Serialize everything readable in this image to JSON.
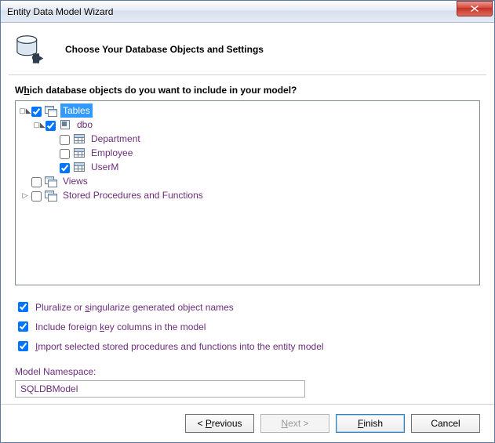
{
  "window": {
    "title": "Entity Data Model Wizard"
  },
  "header": {
    "title": "Choose Your Database Objects and Settings"
  },
  "prompt": {
    "pre": "W",
    "accel": "h",
    "post": "ich database objects do you want to include in your model?"
  },
  "tree": {
    "tables": {
      "label": "Tables",
      "schema": {
        "label": "dbo"
      },
      "items": [
        {
          "label": "Department",
          "checked": false
        },
        {
          "label": "Employee",
          "checked": false
        },
        {
          "label": "UserM",
          "checked": true
        }
      ]
    },
    "views": {
      "label": "Views"
    },
    "sprocs": {
      "label": "Stored Procedures and Functions"
    }
  },
  "options": {
    "pluralize": {
      "pre": "Pluralize or ",
      "accel": "s",
      "post": "ingularize generated object names",
      "checked": true
    },
    "fk": {
      "pre": "Include foreign ",
      "accel": "k",
      "post": "ey columns in the model",
      "checked": true
    },
    "import": {
      "pre": "",
      "accel": "I",
      "post": "mport selected stored procedures and functions into the entity model",
      "checked": true
    }
  },
  "namespace": {
    "label_pre": "",
    "label_accel": "M",
    "label_post": "odel Namespace:",
    "value": "SQLDBModel"
  },
  "buttons": {
    "prev": {
      "pre": "< ",
      "accel": "P",
      "post": "revious"
    },
    "next": {
      "pre": "",
      "accel": "N",
      "post": "ext >"
    },
    "finish": {
      "pre": "",
      "accel": "F",
      "post": "inish"
    },
    "cancel": {
      "label": "Cancel"
    }
  }
}
